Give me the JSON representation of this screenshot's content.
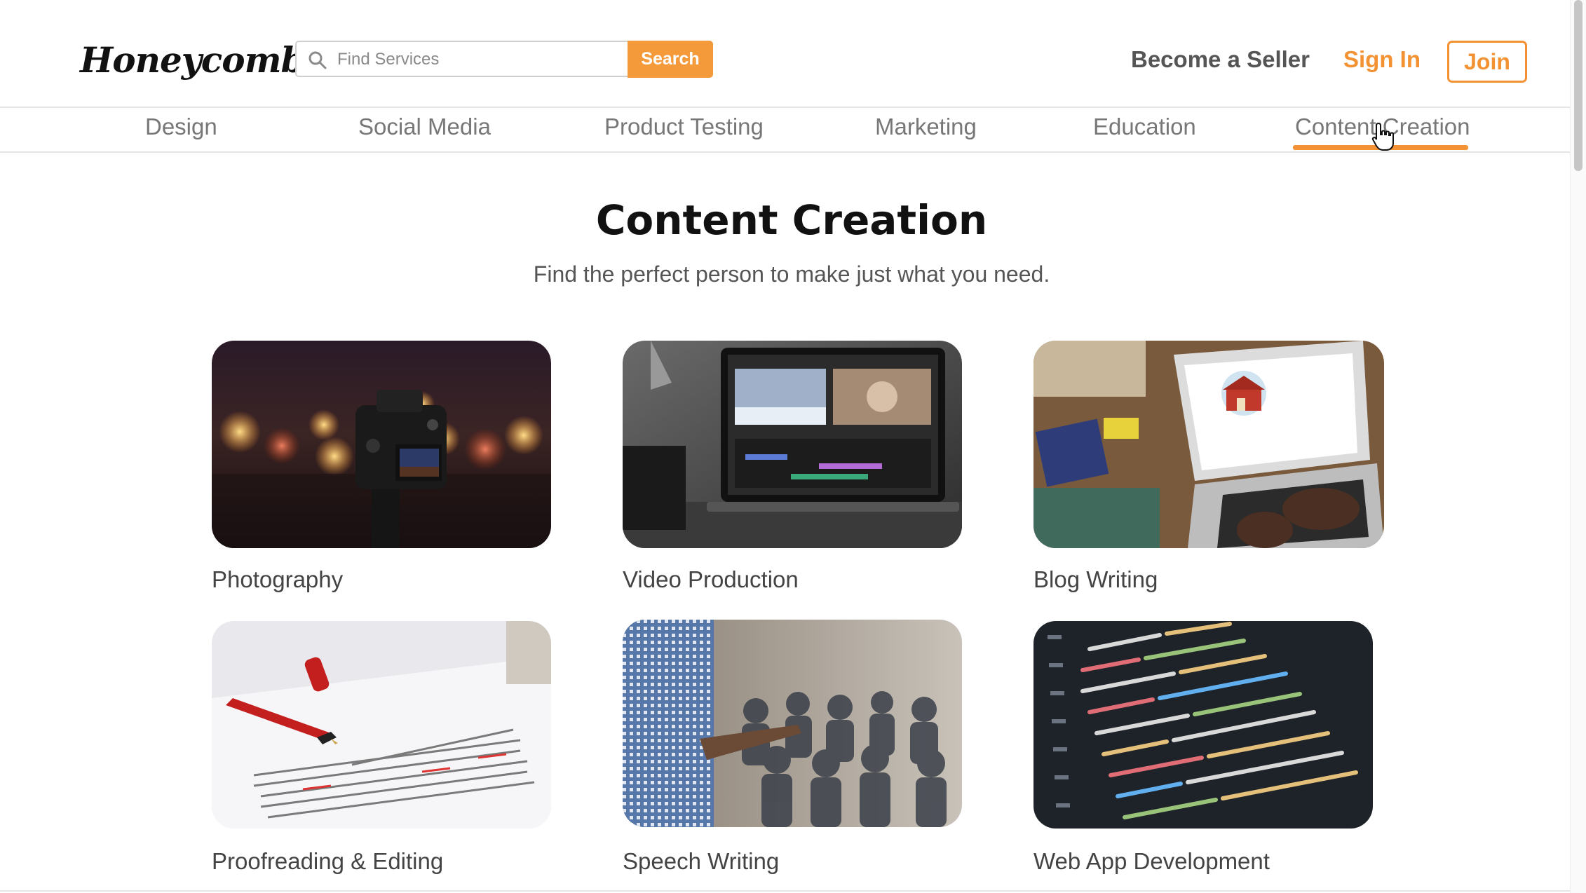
{
  "brand": {
    "name": "Honeycomb",
    "accent": "#f39233",
    "button_color": "#f49a3b"
  },
  "search": {
    "placeholder": "Find Services",
    "value": "",
    "button_label": "Search"
  },
  "header_links": {
    "seller": "Become a Seller",
    "signin": "Sign In",
    "join": "Join"
  },
  "categories": [
    {
      "label": "Design",
      "active": false
    },
    {
      "label": "Social Media",
      "active": false
    },
    {
      "label": "Product Testing",
      "active": false
    },
    {
      "label": "Marketing",
      "active": false
    },
    {
      "label": "Education",
      "active": false
    },
    {
      "label": "Content Creation",
      "active": true
    }
  ],
  "page": {
    "title": "Content Creation",
    "subtitle": "Find the perfect person to make just what you need."
  },
  "services": [
    {
      "label": "Photography",
      "image": "camera-photo"
    },
    {
      "label": "Video Production",
      "image": "laptop-video-editor"
    },
    {
      "label": "Blog Writing",
      "image": "laptop-admissions"
    },
    {
      "label": "Proofreading & Editing",
      "image": "pen-on-document"
    },
    {
      "label": "Speech Writing",
      "image": "speaker-audience"
    },
    {
      "label": "Web App Development",
      "image": "code-screen"
    }
  ],
  "icons": {
    "logo": "honeycomb-logo-icon",
    "search": "search-icon",
    "cursor": "hand-cursor-icon"
  }
}
